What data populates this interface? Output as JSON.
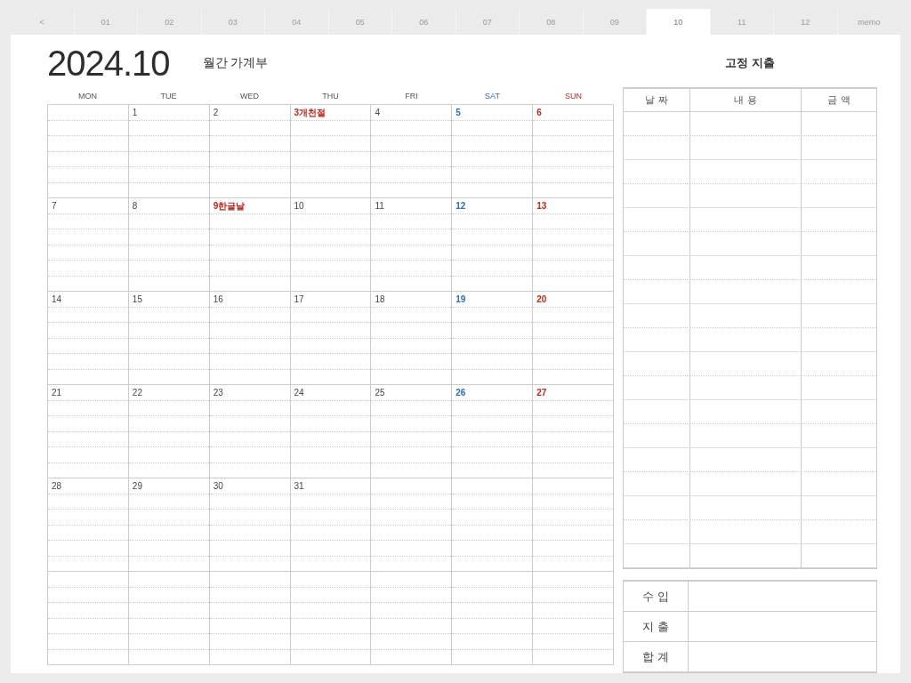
{
  "tabs": [
    {
      "label": "<",
      "selected": false
    },
    {
      "label": "01",
      "selected": false
    },
    {
      "label": "02",
      "selected": false
    },
    {
      "label": "03",
      "selected": false
    },
    {
      "label": "04",
      "selected": false
    },
    {
      "label": "05",
      "selected": false
    },
    {
      "label": "06",
      "selected": false
    },
    {
      "label": "07",
      "selected": false
    },
    {
      "label": "08",
      "selected": false
    },
    {
      "label": "09",
      "selected": false
    },
    {
      "label": "10",
      "selected": true
    },
    {
      "label": "11",
      "selected": false
    },
    {
      "label": "12",
      "selected": false
    },
    {
      "label": "memo",
      "selected": false
    }
  ],
  "title": "2024.10",
  "subtitle": "월간 가계부",
  "calendar": {
    "weekdays": [
      {
        "label": "MON",
        "kind": "weekday"
      },
      {
        "label": "TUE",
        "kind": "weekday"
      },
      {
        "label": "WED",
        "kind": "weekday"
      },
      {
        "label": "THU",
        "kind": "weekday"
      },
      {
        "label": "FRI",
        "kind": "weekday"
      },
      {
        "label": "SAT",
        "kind": "saturday"
      },
      {
        "label": "SUN",
        "kind": "sunday"
      }
    ],
    "weeks": [
      [
        {
          "day": "1",
          "kind": "weekday"
        },
        {
          "day": "2",
          "kind": "weekday"
        },
        {
          "day": "3",
          "note": "개천절",
          "kind": "holiday"
        },
        {
          "day": "4",
          "kind": "weekday"
        },
        {
          "day": "5",
          "kind": "saturday"
        },
        {
          "day": "6",
          "kind": "sunday"
        }
      ],
      [
        {
          "day": "7",
          "kind": "weekday"
        },
        {
          "day": "8",
          "kind": "weekday"
        },
        {
          "day": "9",
          "note": "한글날",
          "kind": "holiday"
        },
        {
          "day": "10",
          "kind": "weekday"
        },
        {
          "day": "11",
          "kind": "weekday"
        },
        {
          "day": "12",
          "kind": "saturday"
        },
        {
          "day": "13",
          "kind": "sunday"
        }
      ],
      [
        {
          "day": "14",
          "kind": "weekday"
        },
        {
          "day": "15",
          "kind": "weekday"
        },
        {
          "day": "16",
          "kind": "weekday"
        },
        {
          "day": "17",
          "kind": "weekday"
        },
        {
          "day": "18",
          "kind": "weekday"
        },
        {
          "day": "19",
          "kind": "saturday"
        },
        {
          "day": "20",
          "kind": "sunday"
        }
      ],
      [
        {
          "day": "21",
          "kind": "weekday"
        },
        {
          "day": "22",
          "kind": "weekday"
        },
        {
          "day": "23",
          "kind": "weekday"
        },
        {
          "day": "24",
          "kind": "weekday"
        },
        {
          "day": "25",
          "kind": "weekday"
        },
        {
          "day": "26",
          "kind": "saturday"
        },
        {
          "day": "27",
          "kind": "sunday"
        }
      ],
      [
        {
          "day": "28",
          "kind": "weekday"
        },
        {
          "day": "29",
          "kind": "weekday"
        },
        {
          "day": "30",
          "kind": "weekday"
        },
        {
          "day": "31",
          "kind": "weekday"
        }
      ]
    ]
  },
  "fixed_expenses": {
    "title": "고정 지출",
    "columns": [
      "날 짜",
      "내 용",
      "금 액"
    ]
  },
  "summary": {
    "rows": [
      {
        "label": "수 입"
      },
      {
        "label": "지 출"
      },
      {
        "label": "합 계"
      }
    ]
  }
}
